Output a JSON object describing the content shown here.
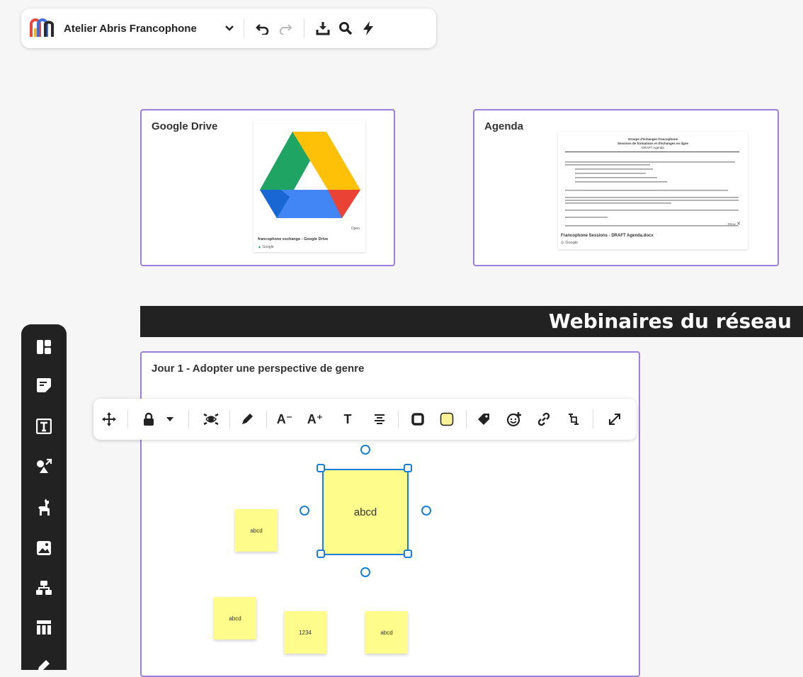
{
  "topbar": {
    "board_title": "Atelier Abris Francophone",
    "icons": [
      "logo-icon",
      "chevron-down-icon",
      "undo-icon",
      "redo-icon",
      "download-icon",
      "search-icon",
      "lightning-icon"
    ]
  },
  "cards": {
    "drive": {
      "title": "Google Drive",
      "open_label": "Open",
      "link_title": "francophone exchange - Google Drive",
      "link_source": "Google"
    },
    "agenda": {
      "title": "Agenda",
      "doc_heading_1": "Groupe d'échanges francophone",
      "doc_heading_2": "Sessions de formations et d'échanges en ligne",
      "doc_heading_3": "DRAFT Agenda",
      "open_label": "Show",
      "link_title": "Francophone Sessions - DRAFT Agenda.docx",
      "link_source": "Google"
    }
  },
  "banner": {
    "text": "Webinaires du réseau"
  },
  "section": {
    "title": "Jour 1 - Adopter une perspective de genre"
  },
  "stickies": {
    "selected": "abcd",
    "left": "abcd",
    "bottom_left": "abcd",
    "bottom_mid": "1234",
    "bottom_right": "abcd"
  },
  "format_toolbar": {
    "font_smaller": "A⁻",
    "font_larger": "A⁺",
    "text_style": "T",
    "sticky_color": "#fbf196"
  },
  "sidebar": {
    "items": [
      "templates-icon",
      "sticky-note-icon",
      "text-icon",
      "shapes-icon",
      "llama-icon",
      "image-icon",
      "diagram-icon",
      "table-icon",
      "pen-icon"
    ]
  },
  "colors": {
    "card_border": "#9b7fdc",
    "selection": "#1a7fd4",
    "sticky": "#fefc8a",
    "banner_bg": "#222222"
  }
}
